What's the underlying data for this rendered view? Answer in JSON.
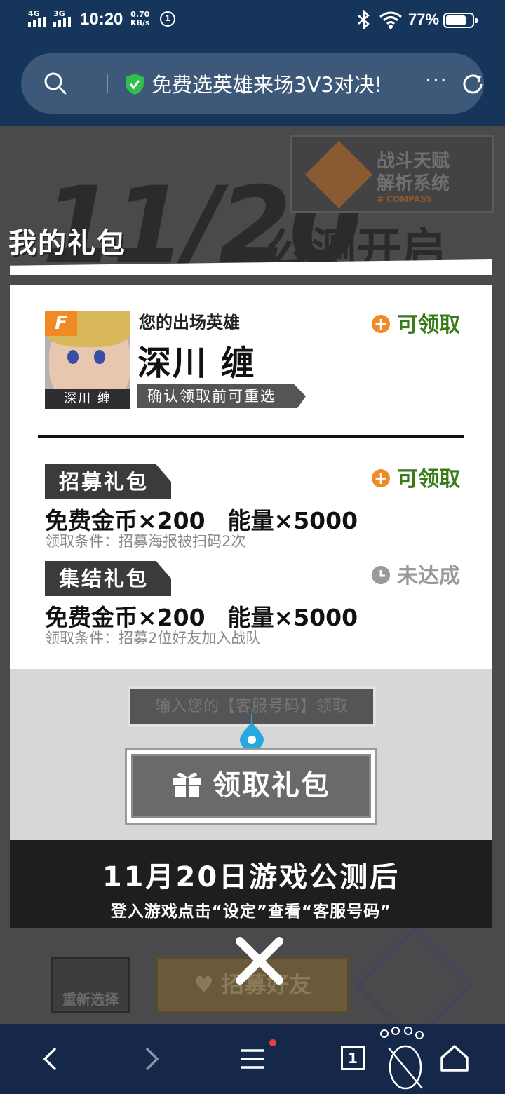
{
  "status_bar": {
    "net1": "4G",
    "net2": "3G",
    "time": "10:20",
    "speed_value": "0.70",
    "speed_unit": "KB/s",
    "badge": "①",
    "battery": "77%",
    "battery_level": 0.77
  },
  "browser": {
    "page_title": "免费选英雄来场3V3对决!",
    "more": "···"
  },
  "background_page": {
    "date_art": "11/20",
    "open_text": "公测开启",
    "compass_line1": "战斗天赋",
    "compass_line2": "解析系统",
    "compass_line3": "# COMPASS",
    "reselect": "重新选择",
    "recruit": "♥ 招募好友"
  },
  "modal": {
    "title": "我的礼包",
    "hero": {
      "avatar_tag": "F",
      "avatar_name": "深川 缠",
      "label": "您的出场英雄",
      "name": "深川 缠",
      "note": "确认领取前可重选",
      "status": "可领取"
    },
    "packs": [
      {
        "name": "招募礼包",
        "reward_coins": "免费金币×200",
        "reward_energy": "能量×5000",
        "condition": "领取条件：招募海报被扫码2次",
        "status": "可领取"
      },
      {
        "name": "集结礼包",
        "reward_coins": "免费金币×200",
        "reward_energy": "能量×5000",
        "condition": "领取条件：招募2位好友加入战队",
        "status": "未达成"
      }
    ],
    "input_placeholder": "输入您的【客服号码】领取",
    "claim_button": "领取礼包",
    "footer_line1": "11月20日游戏公测后",
    "footer_line2": "登入游戏点击“设定”查看“客服号码”"
  },
  "nav": {
    "tab_count": "1"
  },
  "colors": {
    "accent_orange": "#f08a24",
    "claim_green": "#3b7a1a",
    "browser_blue": "#16355b"
  }
}
